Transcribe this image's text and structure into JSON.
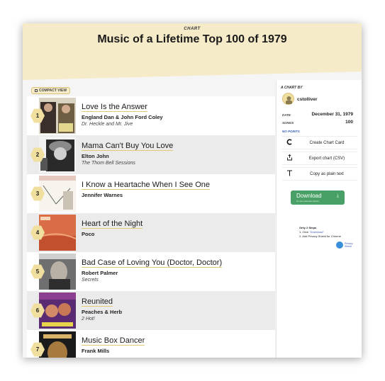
{
  "header": {
    "eyebrow": "CHART",
    "title": "Music of a Lifetime Top 100 of 1979"
  },
  "view_toggle": {
    "label": "COMPACT VIEW"
  },
  "songs": [
    {
      "rank": "1",
      "title": "Love Is the Answer",
      "artist": "England Dan & John Ford Coley",
      "album": "Dr. Heckle and Mr. Jive"
    },
    {
      "rank": "2",
      "title": "Mama Can't Buy You Love",
      "artist": "Elton John",
      "album": "The Thom Bell Sessions"
    },
    {
      "rank": "3",
      "title": "I Know a Heartache When I See One",
      "artist": "Jennifer Warnes",
      "album": ""
    },
    {
      "rank": "4",
      "title": "Heart of the Night",
      "artist": "Poco",
      "album": ""
    },
    {
      "rank": "5",
      "title": "Bad Case of Loving You (Doctor, Doctor)",
      "artist": "Robert Palmer",
      "album": "Secrets"
    },
    {
      "rank": "6",
      "title": "Reunited",
      "artist": "Peaches & Herb",
      "album": "2 Hot!"
    },
    {
      "rank": "7",
      "title": "Music Box Dancer",
      "artist": "Frank Mills",
      "album": ""
    }
  ],
  "sidebar": {
    "chart_by_label": "A CHART BY",
    "username": "cstolliver",
    "date_label": "DATE",
    "date_value": "December 31, 1979",
    "songs_label": "SONGS",
    "songs_value": "100",
    "no_points_label": "NO POINTS",
    "actions": [
      {
        "icon": "chart-card-icon",
        "label": "Create Chart Card"
      },
      {
        "icon": "export-icon",
        "label": "Export chart (CSV)"
      },
      {
        "icon": "text-icon",
        "label": "Copy as plain text"
      }
    ]
  },
  "ad": {
    "download_label": "Download",
    "download_sub": "for use extension (Free)",
    "steps_heading": "Only 2 Steps",
    "step1_prefix": "1. Click ",
    "step1_link": "\"Download\"",
    "step2": "2. Add Privacy Shield for Chrome",
    "logo_text": "Privacy Shield"
  },
  "colors": {
    "hero_bg": "#f5ebc8",
    "accent": "#f1dfa0",
    "download_green": "#49a066",
    "link_blue": "#3a61b5"
  }
}
